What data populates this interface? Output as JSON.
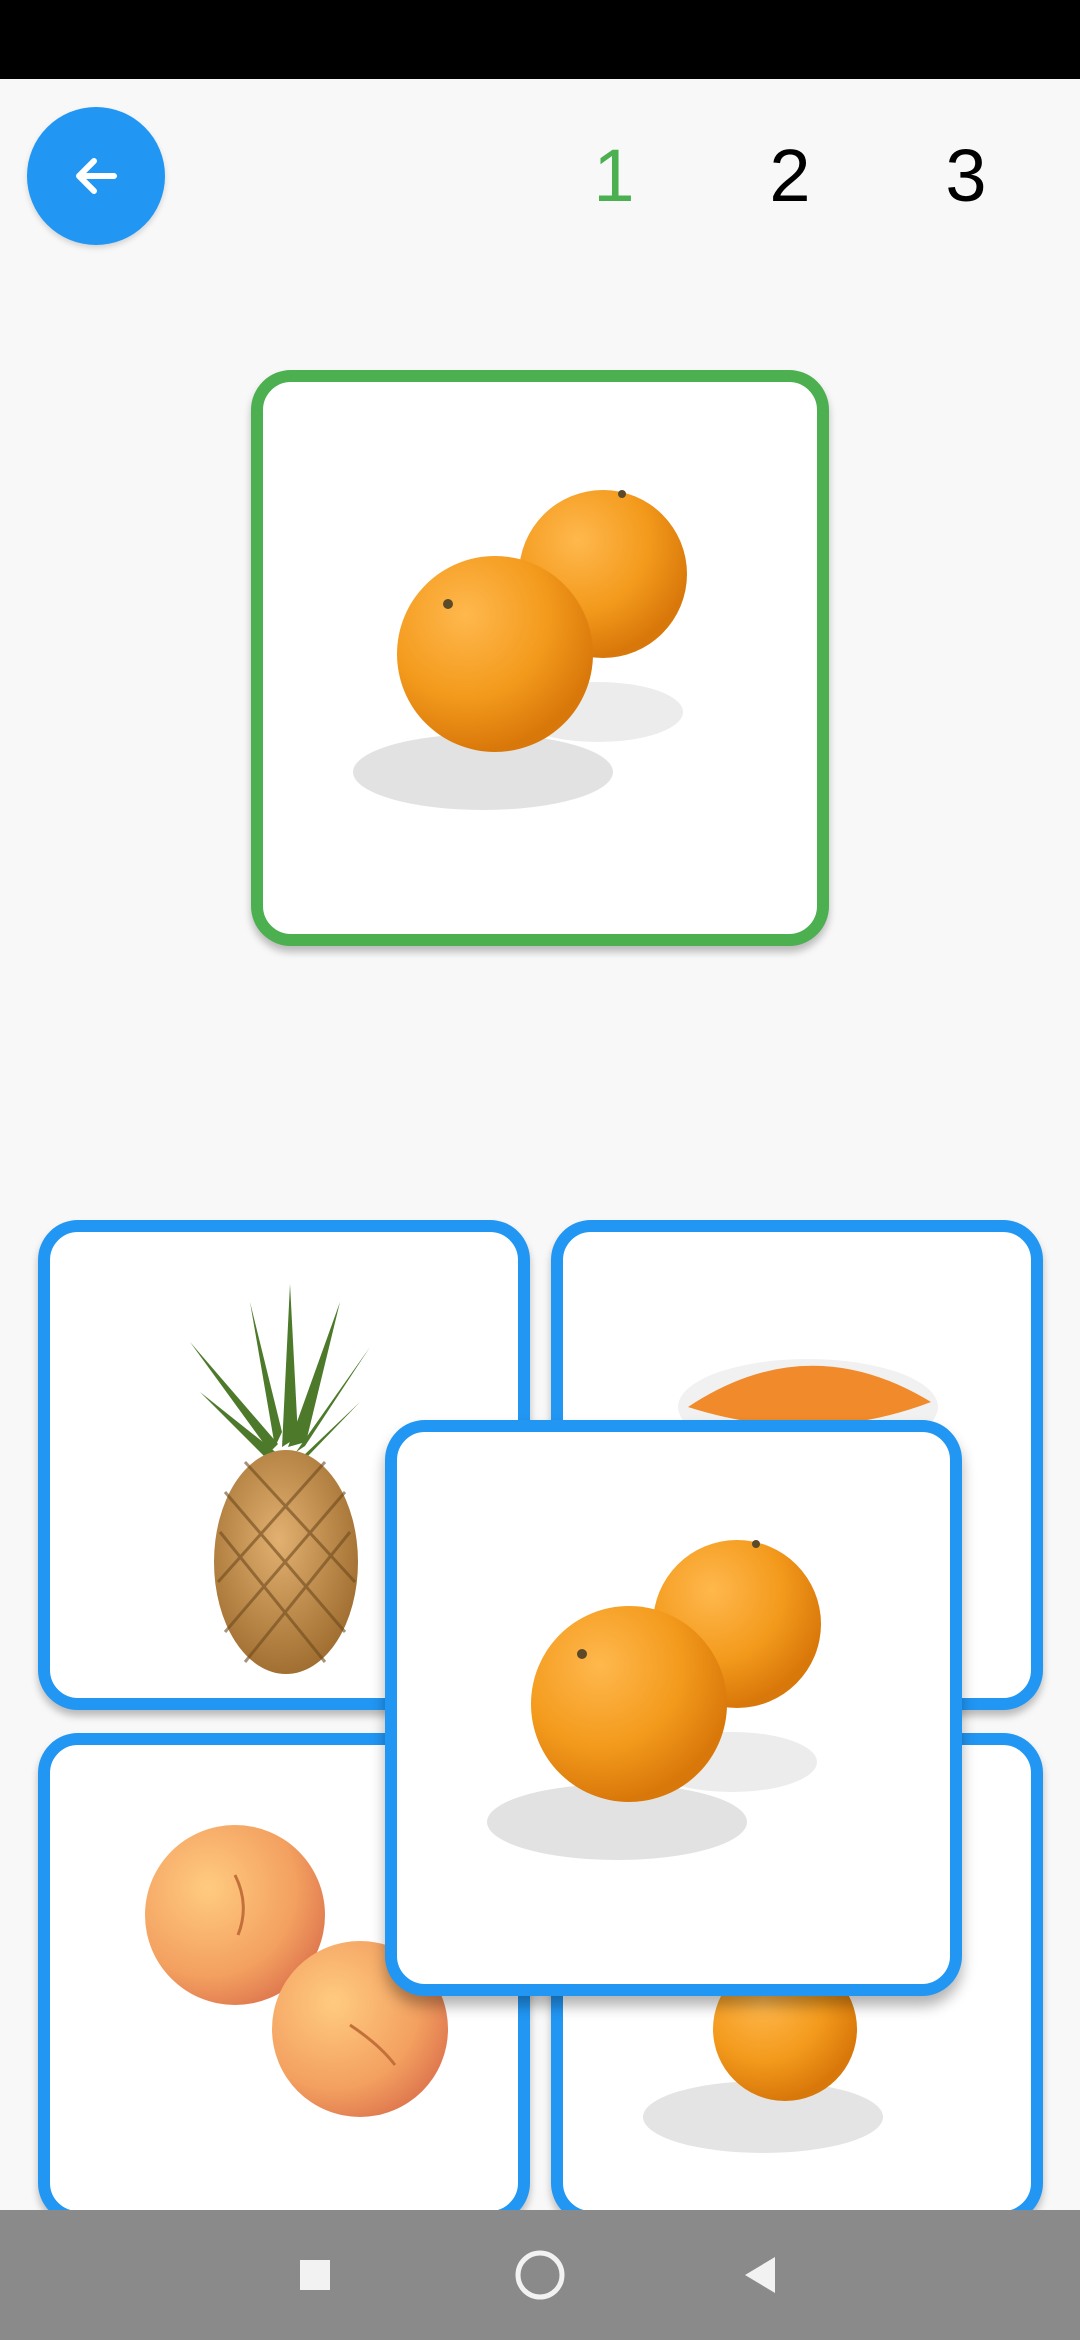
{
  "header": {
    "back_icon": "arrow-left-icon",
    "pages": [
      "1",
      "2",
      "3"
    ],
    "active_page": "1",
    "colors": {
      "active": "#4caf50",
      "inactive": "#000000",
      "accent": "#2196f3"
    }
  },
  "target_card": {
    "fruit": "orange",
    "border_color": "#4caf50"
  },
  "options": [
    {
      "fruit": "pineapple"
    },
    {
      "fruit": "papaya"
    },
    {
      "fruit": "apricot"
    },
    {
      "fruit": "orange"
    }
  ],
  "dragged_card": {
    "fruit": "orange",
    "border_color": "#2196f3"
  },
  "nav": {
    "icons": [
      "recent-apps-icon",
      "home-icon",
      "back-triangle-icon"
    ]
  }
}
